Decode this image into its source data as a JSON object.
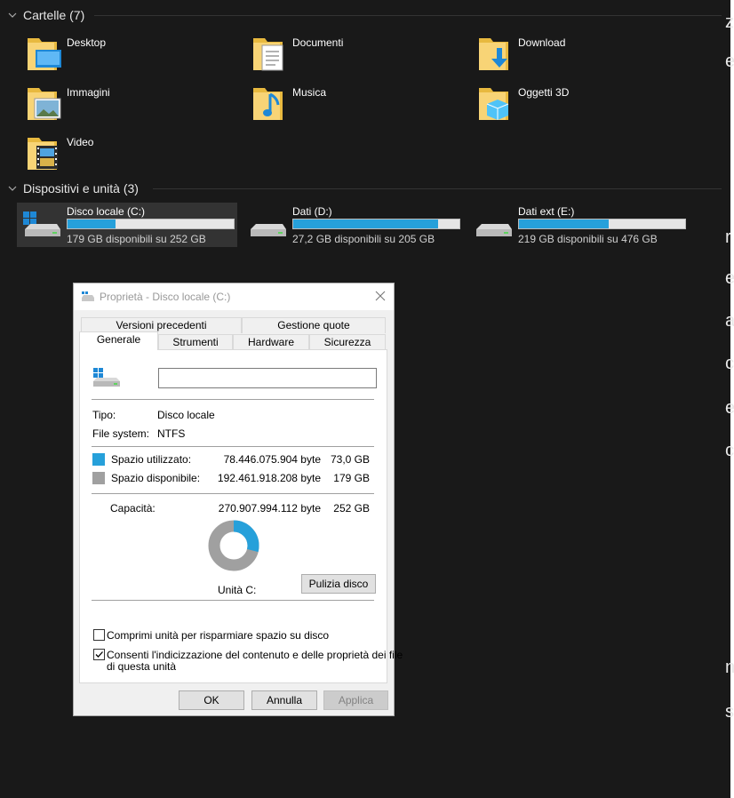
{
  "explorer": {
    "folders_header": "Cartelle (7)",
    "folders": [
      {
        "name": "Desktop",
        "icon": "desktop-folder-icon"
      },
      {
        "name": "Documenti",
        "icon": "documents-folder-icon"
      },
      {
        "name": "Download",
        "icon": "downloads-folder-icon"
      },
      {
        "name": "Immagini",
        "icon": "pictures-folder-icon"
      },
      {
        "name": "Musica",
        "icon": "music-folder-icon"
      },
      {
        "name": "Oggetti 3D",
        "icon": "3d-objects-folder-icon"
      },
      {
        "name": "Video",
        "icon": "videos-folder-icon"
      }
    ],
    "devices_header": "Dispositivi e unità (3)",
    "drives": [
      {
        "name": "Disco locale (C:)",
        "free_text": "179 GB disponibili su 252 GB",
        "used_fraction": 0.29,
        "selected": true
      },
      {
        "name": "Dati (D:)",
        "free_text": "27,2 GB disponibili su 205 GB",
        "used_fraction": 0.87,
        "selected": false
      },
      {
        "name": "Dati ext (E:)",
        "free_text": "219 GB disponibili su 476 GB",
        "used_fraction": 0.54,
        "selected": false
      }
    ],
    "right_edge_chars": [
      "z",
      "e",
      "r",
      "e",
      "a",
      "c",
      "e",
      "c",
      "n",
      "s"
    ]
  },
  "dialog": {
    "title": "Proprietà - Disco locale (C:)",
    "tabs_top": [
      "Versioni precedenti",
      "Gestione quote"
    ],
    "tabs_bottom": [
      "Generale",
      "Strumenti",
      "Hardware",
      "Sicurezza"
    ],
    "active_tab": "Generale",
    "volume_name_value": "",
    "type_label": "Tipo:",
    "type_value": "Disco locale",
    "fs_label": "File system:",
    "fs_value": "NTFS",
    "used_label": "Spazio utilizzato:",
    "used_bytes": "78.446.075.904 byte",
    "used_gb": "73,0 GB",
    "free_label": "Spazio disponibile:",
    "free_bytes": "192.461.918.208 byte",
    "free_gb": "179 GB",
    "capacity_label": "Capacità:",
    "capacity_bytes": "270.907.994.112 byte",
    "capacity_gb": "252 GB",
    "drive_label": "Unità C:",
    "used_fraction": 0.29,
    "cleanup_button": "Pulizia disco",
    "compress_label": "Comprimi unità per risparmiare spazio su disco",
    "compress_checked": false,
    "index_label_line1": "Consenti l'indicizzazione del contenuto e delle proprietà dei file",
    "index_label_line2": "di questa unità",
    "index_checked": true,
    "ok_button": "OK",
    "cancel_button": "Annulla",
    "apply_button": "Applica",
    "colors": {
      "used": "#26a0da",
      "free": "#a0a0a0"
    }
  }
}
